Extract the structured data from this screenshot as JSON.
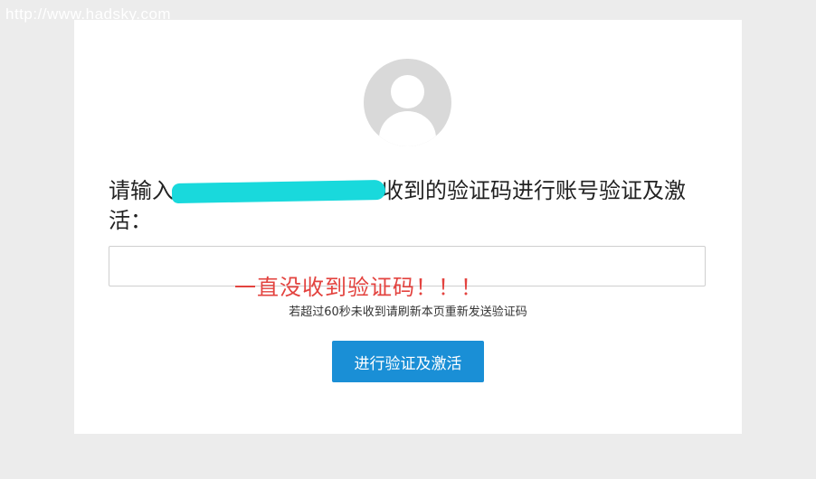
{
  "watermark": "http://www.hadsky.com",
  "verify": {
    "prompt_before": "请输入",
    "prompt_after": "收到的验证码进行账号验证及激活：",
    "code_input_value": "",
    "hint": "若超过60秒未收到请刷新本页重新发送验证码",
    "submit_label": "进行验证及激活"
  },
  "annotation": "一直没收到验证码！！！",
  "colors": {
    "page_bg": "#ececec",
    "card_bg": "#ffffff",
    "button_bg": "#1a8fd6",
    "annotation": "#e3433f",
    "redaction": "#19d9dc"
  }
}
